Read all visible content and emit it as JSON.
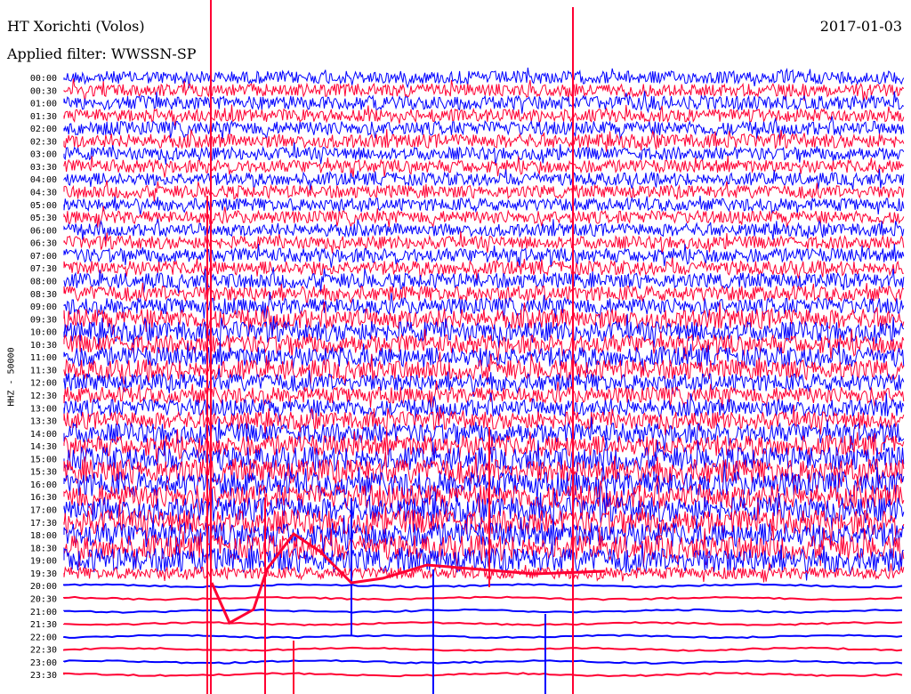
{
  "header": {
    "title": "HT Xorichti (Volos)",
    "filter": "Applied filter: WWSSN-SP",
    "date": "2017-01-03"
  },
  "chart_data": {
    "type": "line",
    "subtype": "helicorder",
    "title": "HT Xorichti (Volos)",
    "subtitle": "Applied filter: WWSSN-SP",
    "date": "2017-01-03",
    "ylabel": "HHZ - 50000",
    "xlabel": "",
    "grid": false,
    "legend": "none",
    "colors": [
      "#0000ff",
      "#ff0033"
    ],
    "rows": [
      {
        "time": "00:00",
        "color": "#0000ff",
        "noise": 0.55
      },
      {
        "time": "00:30",
        "color": "#ff0033",
        "noise": 0.55
      },
      {
        "time": "01:00",
        "color": "#0000ff",
        "noise": 0.6
      },
      {
        "time": "01:30",
        "color": "#ff0033",
        "noise": 0.55
      },
      {
        "time": "02:00",
        "color": "#0000ff",
        "noise": 0.6
      },
      {
        "time": "02:30",
        "color": "#ff0033",
        "noise": 0.6
      },
      {
        "time": "03:00",
        "color": "#0000ff",
        "noise": 0.55
      },
      {
        "time": "03:30",
        "color": "#ff0033",
        "noise": 0.55
      },
      {
        "time": "04:00",
        "color": "#0000ff",
        "noise": 0.55
      },
      {
        "time": "04:30",
        "color": "#ff0033",
        "noise": 0.55
      },
      {
        "time": "05:00",
        "color": "#0000ff",
        "noise": 0.55
      },
      {
        "time": "05:30",
        "color": "#ff0033",
        "noise": 0.55
      },
      {
        "time": "06:00",
        "color": "#0000ff",
        "noise": 0.55
      },
      {
        "time": "06:30",
        "color": "#ff0033",
        "noise": 0.55
      },
      {
        "time": "07:00",
        "color": "#0000ff",
        "noise": 0.6
      },
      {
        "time": "07:30",
        "color": "#ff0033",
        "noise": 0.6
      },
      {
        "time": "08:00",
        "color": "#0000ff",
        "noise": 0.65
      },
      {
        "time": "08:30",
        "color": "#ff0033",
        "noise": 0.65
      },
      {
        "time": "09:00",
        "color": "#0000ff",
        "noise": 0.7
      },
      {
        "time": "09:30",
        "color": "#ff0033",
        "noise": 0.85
      },
      {
        "time": "10:00",
        "color": "#0000ff",
        "noise": 0.85
      },
      {
        "time": "10:30",
        "color": "#ff0033",
        "noise": 0.8
      },
      {
        "time": "11:00",
        "color": "#0000ff",
        "noise": 0.85
      },
      {
        "time": "11:30",
        "color": "#ff0033",
        "noise": 0.85
      },
      {
        "time": "12:00",
        "color": "#0000ff",
        "noise": 0.75
      },
      {
        "time": "12:30",
        "color": "#ff0033",
        "noise": 0.7
      },
      {
        "time": "13:00",
        "color": "#0000ff",
        "noise": 0.75
      },
      {
        "time": "13:30",
        "color": "#ff0033",
        "noise": 0.75
      },
      {
        "time": "14:00",
        "color": "#0000ff",
        "noise": 0.85
      },
      {
        "time": "14:30",
        "color": "#ff0033",
        "noise": 0.9
      },
      {
        "time": "15:00",
        "color": "#0000ff",
        "noise": 1.0
      },
      {
        "time": "15:30",
        "color": "#ff0033",
        "noise": 1.05
      },
      {
        "time": "16:00",
        "color": "#0000ff",
        "noise": 1.05
      },
      {
        "time": "16:30",
        "color": "#ff0033",
        "noise": 1.05
      },
      {
        "time": "17:00",
        "color": "#0000ff",
        "noise": 1.05
      },
      {
        "time": "17:30",
        "color": "#ff0033",
        "noise": 1.05
      },
      {
        "time": "18:00",
        "color": "#0000ff",
        "noise": 1.05
      },
      {
        "time": "18:30",
        "color": "#ff0033",
        "noise": 1.05
      },
      {
        "time": "19:00",
        "color": "#0000ff",
        "noise": 1.05
      },
      {
        "time": "19:30",
        "color": "#ff0033",
        "noise": 0.5
      },
      {
        "time": "20:00",
        "color": "#0000ff",
        "noise": 0.08
      },
      {
        "time": "20:30",
        "color": "#ff0033",
        "noise": 0.08
      },
      {
        "time": "21:00",
        "color": "#0000ff",
        "noise": 0.08
      },
      {
        "time": "21:30",
        "color": "#ff0033",
        "noise": 0.08
      },
      {
        "time": "22:00",
        "color": "#0000ff",
        "noise": 0.08
      },
      {
        "time": "22:30",
        "color": "#ff0033",
        "noise": 0.08
      },
      {
        "time": "23:00",
        "color": "#0000ff",
        "noise": 0.08
      },
      {
        "time": "23:30",
        "color": "#ff0033",
        "noise": 0.08
      }
    ]
  }
}
